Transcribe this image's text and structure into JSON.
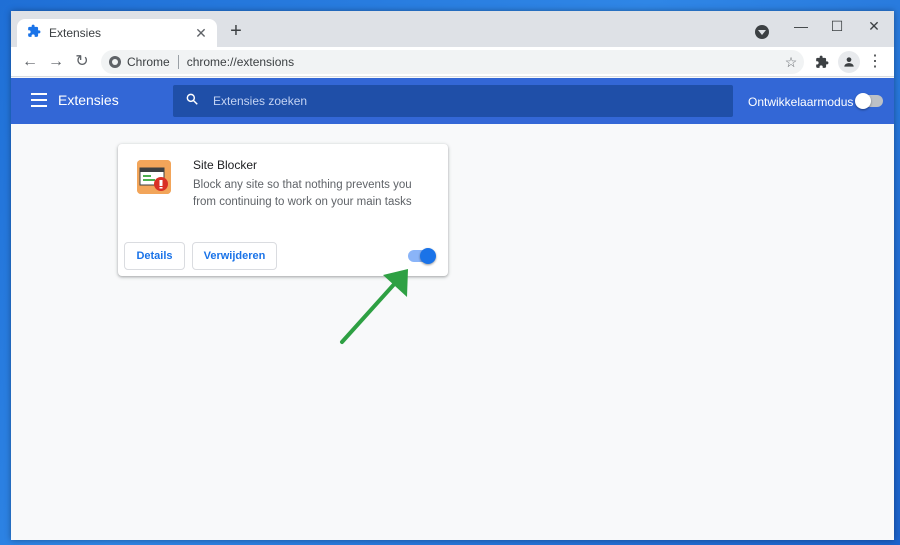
{
  "tab": {
    "title": "Extensies",
    "close_glyph": "✕"
  },
  "window_controls": {
    "minimize": "—",
    "maximize": "☐",
    "close": "✕"
  },
  "toolbar": {
    "back": "←",
    "forward": "→",
    "reload": "↻",
    "site_chip": "Chrome",
    "url": "chrome://extensions",
    "star": "☆",
    "menu": "⋮"
  },
  "header": {
    "title": "Extensies",
    "search_placeholder": "Extensies zoeken",
    "developer_mode_label": "Ontwikkelaarmodus",
    "developer_mode_on": false
  },
  "extension": {
    "name": "Site Blocker",
    "description": "Block any site so that nothing prevents you from continuing to work on your main tasks",
    "details_label": "Details",
    "remove_label": "Verwijderen",
    "enabled": true
  },
  "colors": {
    "header_bg": "#3367d6",
    "search_bg": "#1f4fa8",
    "accent": "#1a73e8",
    "annotation_arrow": "#2ea043"
  },
  "icons": [
    "puzzle-icon",
    "close-icon",
    "plus-icon",
    "back-arrow-icon",
    "forward-arrow-icon",
    "reload-icon",
    "site-info-icon",
    "star-icon",
    "extensions-icon",
    "profile-icon",
    "kebab-menu-icon",
    "hamburger-icon",
    "search-icon",
    "site-blocker-icon"
  ]
}
